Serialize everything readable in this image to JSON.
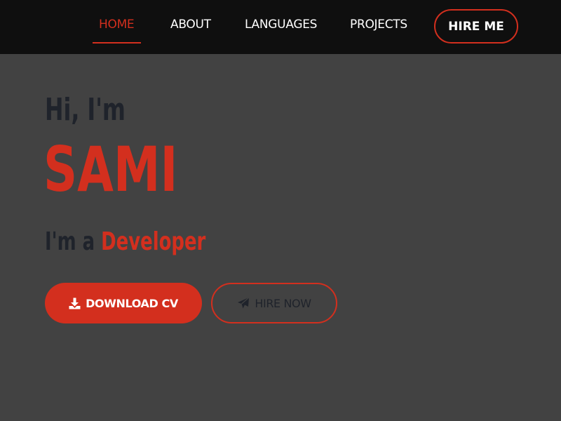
{
  "nav": {
    "items": [
      {
        "label": "HOME",
        "active": true
      },
      {
        "label": "ABOUT",
        "active": false
      },
      {
        "label": "LANGUAGES",
        "active": false
      },
      {
        "label": "PROJECTS",
        "active": false
      }
    ],
    "cta_label": "HIRE ME"
  },
  "hero": {
    "greeting": "Hi, I'm",
    "name": "SAMI",
    "role_prefix": "I'm a",
    "role": "Developer"
  },
  "buttons": {
    "download_cv": {
      "label": "DOWNLOAD CV",
      "icon": "download-icon"
    },
    "hire_now": {
      "label": "HIRE NOW",
      "icon": "paper-plane-icon"
    }
  },
  "colors": {
    "accent": "#d32f1e",
    "navbar_bg": "#0f0f0f",
    "page_bg": "#424242",
    "heading_dark": "#1f232b"
  }
}
